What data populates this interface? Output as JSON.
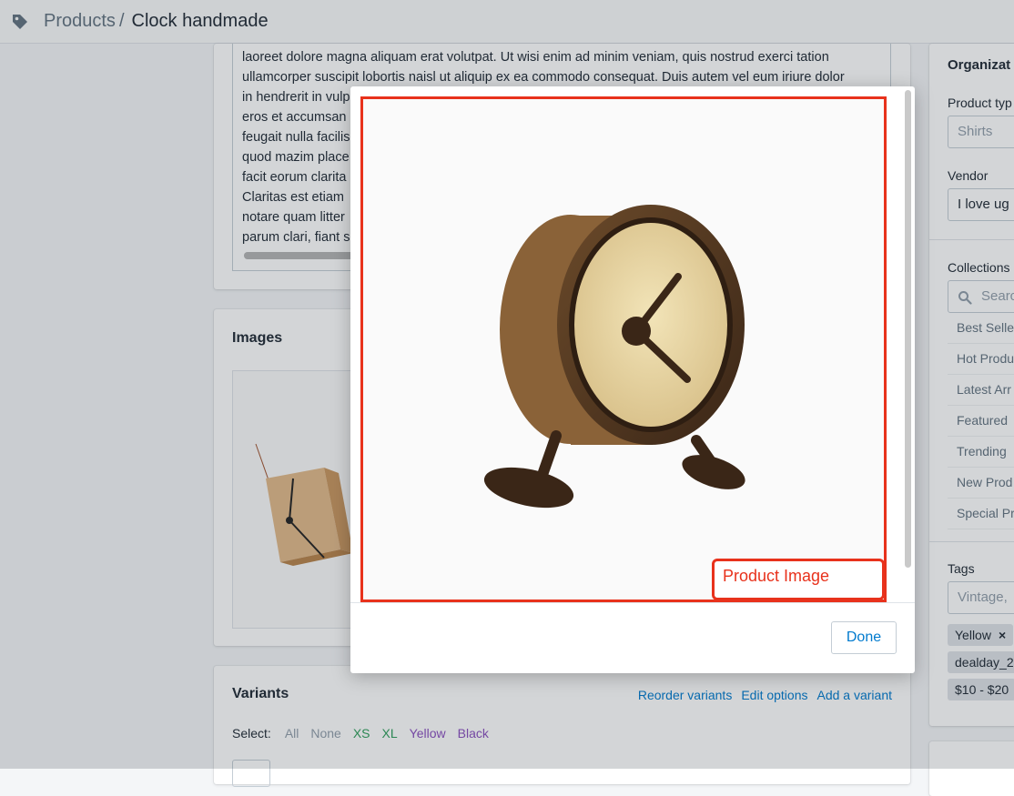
{
  "header": {
    "breadcrumb_parent": "Products",
    "breadcrumb_separator": "/",
    "title": "Clock handmade"
  },
  "description": {
    "lines": [
      "laoreet dolore magna aliquam erat volutpat. Ut wisi enim ad minim veniam, quis nostrud exerci tation",
      "ullamcorper suscipit lobortis naisl ut aliquip ex ea commodo consequat. Duis autem vel eum iriure dolor",
      "in hendrerit in vulp",
      "eros et accumsan",
      "feugait nulla facilis",
      "quod mazim place",
      "facit eorum clarita",
      "Claritas est etiam",
      "notare quam litter",
      "parum clari, fiant s"
    ]
  },
  "images": {
    "title": "Images"
  },
  "variants": {
    "title": "Variants",
    "actions": [
      "Reorder variants",
      "Edit options",
      "Add a variant"
    ],
    "select_label": "Select:",
    "select_options": [
      {
        "label": "All",
        "color": "#919eab"
      },
      {
        "label": "None",
        "color": "#919eab"
      },
      {
        "label": "XS",
        "color": "#2e9e5b"
      },
      {
        "label": "XL",
        "color": "#2e9e5b"
      },
      {
        "label": "Yellow",
        "color": "#8a4fbf"
      },
      {
        "label": "Black",
        "color": "#8a4fbf"
      }
    ]
  },
  "organization": {
    "title": "Organizat",
    "product_type_label": "Product typ",
    "product_type_placeholder": "Shirts",
    "vendor_label": "Vendor",
    "vendor_value": "I love ug",
    "collections_label": "Collections",
    "collections_search_placeholder": "Searc",
    "collections": [
      "Best Selle",
      "Hot Produ",
      "Latest Arr",
      "Featured",
      "Trending",
      "New Prod",
      "Special Pr"
    ],
    "tags_label": "Tags",
    "tags_placeholder": "Vintage,",
    "tags": [
      "Yellow",
      "dealday_2",
      "$10 - $20"
    ],
    "tag_remove": "×"
  },
  "modal": {
    "done_label": "Done",
    "annotation_label": "Product Image"
  },
  "colors": {
    "accent": "#007ace",
    "highlight": "#e8321c",
    "overlay": "rgba(33,43,54,0.2)"
  }
}
